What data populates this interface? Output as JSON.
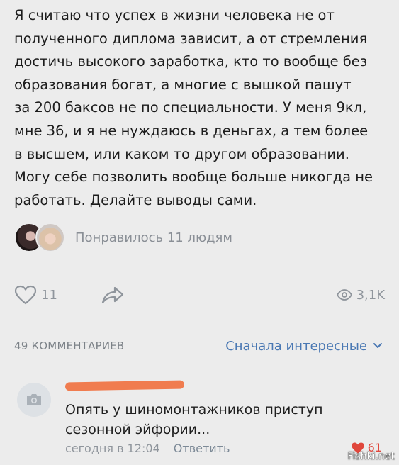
{
  "post": {
    "lines": [
      "Я считаю что успех в жизни человека не от",
      "полученного диплома зависит, а от стремления",
      "достичь высокого заработка, кто то вообще без",
      "образования богат, а многие с вышкой пашут",
      "за 200 баксов не по специальности. У меня 9кл,",
      "мне 36, и я не нуждаюсь в деньгах, а тем более",
      "в высшем, или каком то другом образовании.",
      "Могу себе позволить вообще больше никогда не",
      "работать. Делайте выводы сами."
    ]
  },
  "likers": {
    "text": "Понравилось 11 людям"
  },
  "actions": {
    "likes_count": "11",
    "views_count": "3,1K"
  },
  "comments": {
    "count_label": "49 КОММЕНТАРИЕВ",
    "sort_label": "Сначала интересные",
    "items": [
      {
        "text_lines": [
          "Опять у шиномонтажников приступ",
          "сезонной эйфории..."
        ],
        "time": "сегодня в 12:04",
        "reply_label": "Ответить",
        "likes": "61"
      }
    ]
  },
  "watermark": "Fishki.net",
  "colors": {
    "background": "#ececec",
    "link": "#4a78b3",
    "muted": "#8f959c",
    "like_red": "#e0473c",
    "redaction": "#f07c4f"
  },
  "icons": [
    "heart-outline-icon",
    "share-arrow-icon",
    "eye-icon",
    "chevron-down-icon",
    "camera-icon",
    "heart-filled-icon"
  ]
}
